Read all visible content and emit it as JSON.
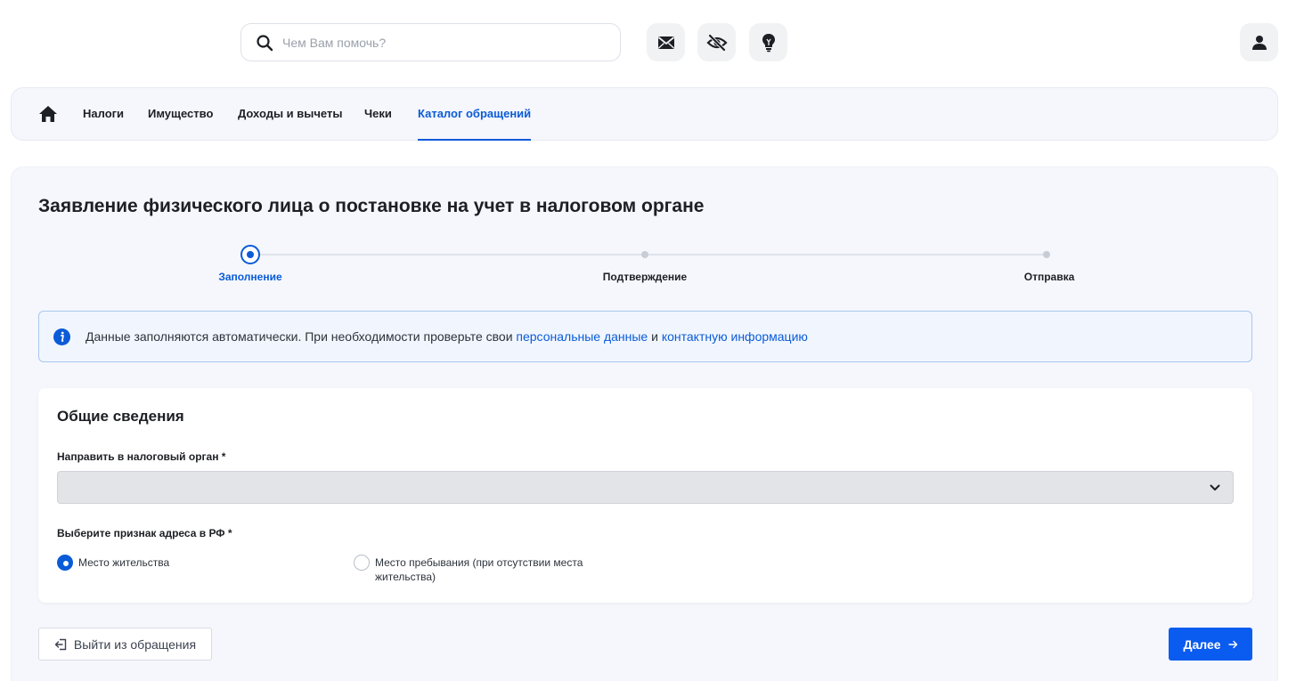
{
  "search": {
    "placeholder": "Чем Вам помочь?"
  },
  "header": {
    "icons": [
      "mail-icon",
      "eye-off-icon",
      "lightbulb-icon",
      "user-icon"
    ]
  },
  "nav": {
    "home_icon": "home-icon",
    "tabs": [
      {
        "label": "Налоги",
        "active": false
      },
      {
        "label": "Имущество",
        "active": false
      },
      {
        "label": "Доходы и вычеты",
        "active": false
      },
      {
        "label": "Чеки",
        "active": false
      },
      {
        "label": "Каталог обращений",
        "active": true
      }
    ]
  },
  "page": {
    "title": "Заявление физического лица о постановке на учет в налоговом органе"
  },
  "stepper": {
    "steps": [
      {
        "label": "Заполнение",
        "state": "current"
      },
      {
        "label": "Подтверждение",
        "state": "upcoming"
      },
      {
        "label": "Отправка",
        "state": "upcoming"
      }
    ]
  },
  "info": {
    "text": "Данные заполняются автоматически. При необходимости проверьте свои ",
    "link1": "персональные данные",
    "conj": " и ",
    "link2": "контактную информацию"
  },
  "form": {
    "section_title": "Общие сведения",
    "tax_authority_label": "Направить в налоговый орган *",
    "tax_authority_value": "",
    "address_label": "Выберите признак адреса в РФ *",
    "address_options": [
      {
        "label": "Место жительства",
        "checked": true
      },
      {
        "label": "Место пребывания (при отсутствии места жительства)",
        "checked": false
      }
    ]
  },
  "actions": {
    "exit_label": "Выйти из обращения",
    "next_label": "Далее"
  },
  "colors": {
    "accent": "#0a5bd8",
    "primary_button": "#0a5bef",
    "panel_bg": "#f5f7fc"
  }
}
